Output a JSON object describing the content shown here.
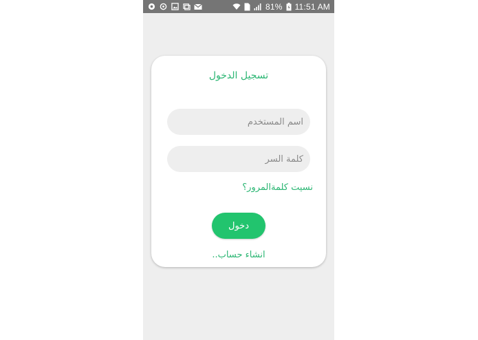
{
  "status_bar": {
    "battery": "81%",
    "time": "11:51 AM",
    "sim": "2",
    "left_icons": [
      "chat-icon",
      "sync-icon",
      "image-icon",
      "gallery-icon",
      "mail-icon"
    ],
    "right_icons": [
      "wifi-icon",
      "sim-icon",
      "signal-icon",
      "battery-icon"
    ]
  },
  "login": {
    "title": "تسجيل الدخول",
    "username_placeholder": "اسم المستخدم",
    "password_placeholder": "كلمة السر",
    "forgot_password": "نسيت كلمةالمرور؟",
    "login_button": "دخول",
    "create_account": "انشاء حساب.."
  },
  "colors": {
    "accent": "#2bb673",
    "button": "#22c46e",
    "background": "#eeeeee",
    "status_bar": "#757575"
  }
}
